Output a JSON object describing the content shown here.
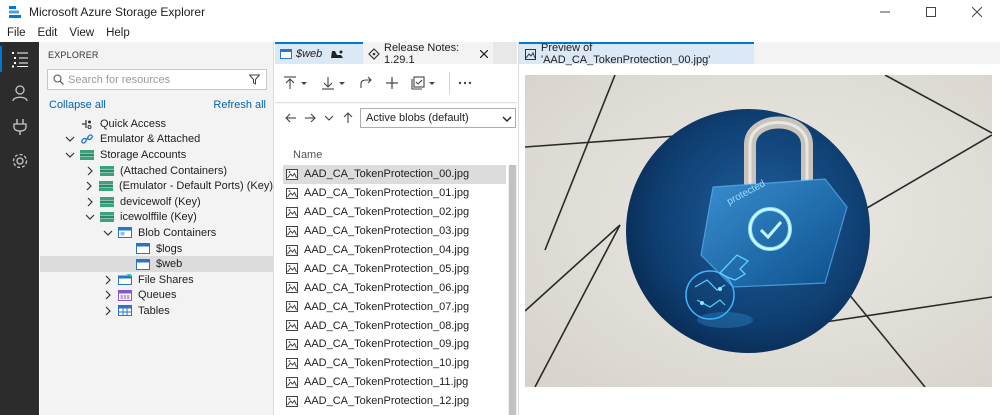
{
  "window": {
    "title": "Microsoft Azure Storage Explorer",
    "controls": [
      "minimize",
      "maximize",
      "close"
    ]
  },
  "menu": [
    "File",
    "Edit",
    "View",
    "Help"
  ],
  "activity_bar": {
    "items": [
      {
        "name": "explorer-icon",
        "active": true
      },
      {
        "name": "account-icon",
        "active": false
      },
      {
        "name": "plug-icon",
        "active": false
      },
      {
        "name": "settings-gear-icon",
        "active": false
      }
    ]
  },
  "explorer": {
    "header": "EXPLORER",
    "search_placeholder": "Search for resources",
    "collapse_all": "Collapse all",
    "refresh_all": "Refresh all",
    "tree": [
      {
        "label": "Quick Access",
        "level": 0,
        "expander": "none",
        "icon": "quick-access-icon",
        "selected": false
      },
      {
        "label": "Emulator & Attached",
        "level": 0,
        "expander": "open",
        "icon": "link-icon",
        "selected": false
      },
      {
        "label": "Storage Accounts",
        "level": 1,
        "expander": "open",
        "icon": "storage-account-icon",
        "selected": false
      },
      {
        "label": "(Attached Containers)",
        "level": 2,
        "expander": "closed",
        "icon": "storage-account-icon",
        "selected": false
      },
      {
        "label": "(Emulator - Default Ports) (Key)",
        "level": 2,
        "expander": "closed",
        "icon": "storage-account-icon",
        "selected": false
      },
      {
        "label": "devicewolf (Key)",
        "level": 2,
        "expander": "closed",
        "icon": "storage-account-icon",
        "selected": false
      },
      {
        "label": "icewolffile (Key)",
        "level": 2,
        "expander": "open",
        "icon": "storage-account-icon",
        "selected": false
      },
      {
        "label": "Blob Containers",
        "level": 3,
        "expander": "open",
        "icon": "blob-containers-icon",
        "selected": false
      },
      {
        "label": "$logs",
        "level": 4,
        "expander": "none",
        "icon": "container-icon",
        "selected": false
      },
      {
        "label": "$web",
        "level": 4,
        "expander": "none",
        "icon": "container-icon",
        "selected": true
      },
      {
        "label": "File Shares",
        "level": 3,
        "expander": "closed",
        "icon": "file-shares-icon",
        "selected": false
      },
      {
        "label": "Queues",
        "level": 3,
        "expander": "closed",
        "icon": "queues-icon",
        "selected": false
      },
      {
        "label": "Tables",
        "level": 3,
        "expander": "closed",
        "icon": "tables-icon",
        "selected": false
      }
    ]
  },
  "editor_tabs": [
    {
      "label": "$web",
      "active": true,
      "italic": true
    },
    {
      "label": "Release Notes: 1.29.1",
      "active": false,
      "italic": false
    }
  ],
  "container_view": {
    "view_select": "Active blobs (default)",
    "column_name": "Name",
    "files": [
      "AAD_CA_TokenProtection_00.jpg",
      "AAD_CA_TokenProtection_01.jpg",
      "AAD_CA_TokenProtection_02.jpg",
      "AAD_CA_TokenProtection_03.jpg",
      "AAD_CA_TokenProtection_04.jpg",
      "AAD_CA_TokenProtection_05.jpg",
      "AAD_CA_TokenProtection_06.jpg",
      "AAD_CA_TokenProtection_07.jpg",
      "AAD_CA_TokenProtection_08.jpg",
      "AAD_CA_TokenProtection_09.jpg",
      "AAD_CA_TokenProtection_10.jpg",
      "AAD_CA_TokenProtection_11.jpg",
      "AAD_CA_TokenProtection_12.jpg"
    ],
    "selected_index": 0
  },
  "preview": {
    "tab_label": "Preview of 'AAD_CA_TokenProtection_00.jpg'",
    "image_text": "protected"
  },
  "colors": {
    "accent": "#0078d4",
    "activity_bar": "#2c2c2c",
    "active_tab": "#dbe8f5",
    "selection": "#dcdcdc",
    "link": "#0063b1"
  }
}
